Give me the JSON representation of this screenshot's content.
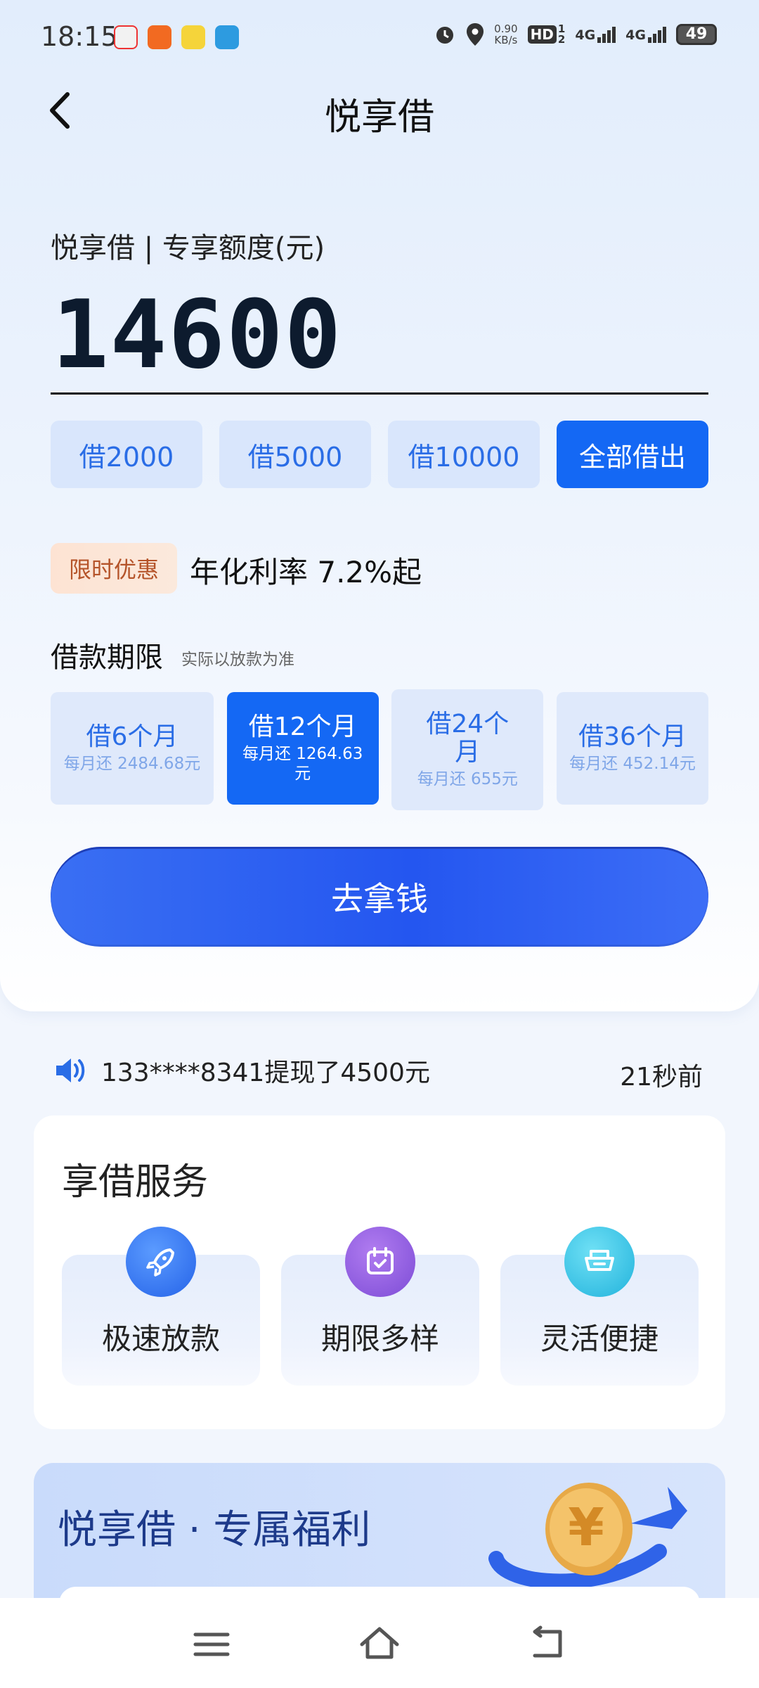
{
  "status": {
    "time": "18:15",
    "speed_value": "0.90",
    "speed_unit": "KB/s",
    "hd_label": "HD",
    "sim_primary": "1",
    "sim_secondary": "2",
    "net1": "4G",
    "net2": "4G",
    "battery": "49"
  },
  "header": {
    "title": "悦享借"
  },
  "loan": {
    "quota_label": "悦享借 | 专享额度(元)",
    "amount": "14600",
    "chips": [
      "借2000",
      "借5000",
      "借10000",
      "全部借出"
    ],
    "active_chip": 3,
    "promo_badge": "限时优惠",
    "rate_text": "年化利率 7.2%起",
    "term_title": "借款期限",
    "term_note": "实际以放款为准",
    "terms": [
      {
        "label": "借6个月",
        "monthly": "每月还 2484.68元"
      },
      {
        "label": "借12个月",
        "monthly": "每月还 1264.63元"
      },
      {
        "label": "借24个月",
        "monthly": "每月还 655元"
      },
      {
        "label": "借36个月",
        "monthly": "每月还 452.14元"
      }
    ],
    "active_term": 1,
    "cta_label": "去拿钱"
  },
  "notice": {
    "text": "133****8341提现了4500元",
    "time": "21秒前"
  },
  "services": {
    "title": "享借服务",
    "items": [
      {
        "label": "极速放款",
        "icon": "rocket-icon",
        "color": "#3a78f2"
      },
      {
        "label": "期限多样",
        "icon": "calendar-icon",
        "color": "#8a5ce0"
      },
      {
        "label": "灵活便捷",
        "icon": "wallet-icon",
        "color": "#2fc3e6"
      }
    ]
  },
  "welfare": {
    "title": "悦享借 · 专属福利",
    "coin_symbol": "¥"
  },
  "colors": {
    "primary": "#1468f4",
    "cta": "#2456f0",
    "promo": "#fde3d3"
  }
}
